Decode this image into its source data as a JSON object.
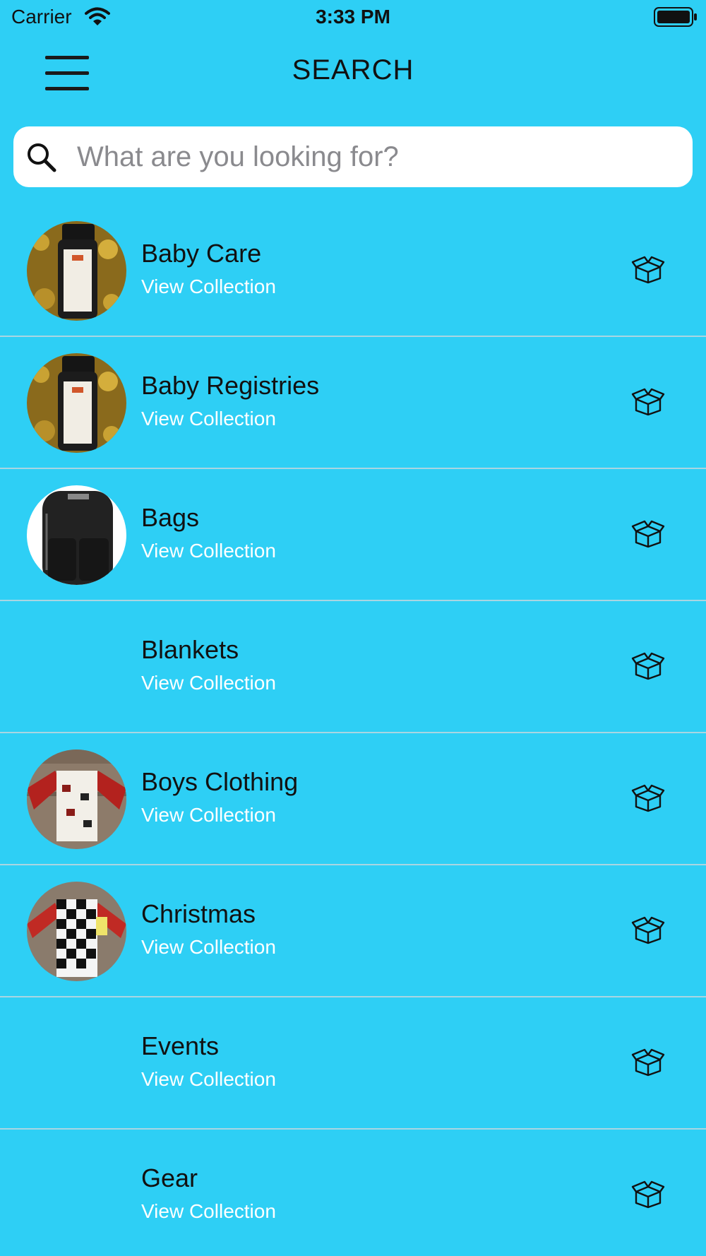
{
  "status_bar": {
    "carrier": "Carrier",
    "time": "3:33 PM"
  },
  "nav": {
    "title": "SEARCH"
  },
  "search": {
    "placeholder": "What are you looking for?",
    "value": ""
  },
  "collections": [
    {
      "title": "Baby Care",
      "subtitle": "View Collection",
      "thumb": "oil-bottle-gold"
    },
    {
      "title": "Baby Registries",
      "subtitle": "View Collection",
      "thumb": "oil-bottle-gold"
    },
    {
      "title": "Bags",
      "subtitle": "View Collection",
      "thumb": "black-backpack"
    },
    {
      "title": "Blankets",
      "subtitle": "View Collection",
      "thumb": ""
    },
    {
      "title": "Boys Clothing",
      "subtitle": "View Collection",
      "thumb": "raglan-shirt"
    },
    {
      "title": "Christmas",
      "subtitle": "View Collection",
      "thumb": "plaid-sleeper"
    },
    {
      "title": "Events",
      "subtitle": "View Collection",
      "thumb": ""
    },
    {
      "title": "Gear",
      "subtitle": "View Collection",
      "thumb": ""
    }
  ],
  "icons": {
    "row_action": "gift-box-icon",
    "menu": "hamburger-menu-icon",
    "search": "search-icon"
  },
  "colors": {
    "background": "#2ecff5",
    "subtitle": "#ffffff",
    "divider": "#a9d6e2"
  }
}
